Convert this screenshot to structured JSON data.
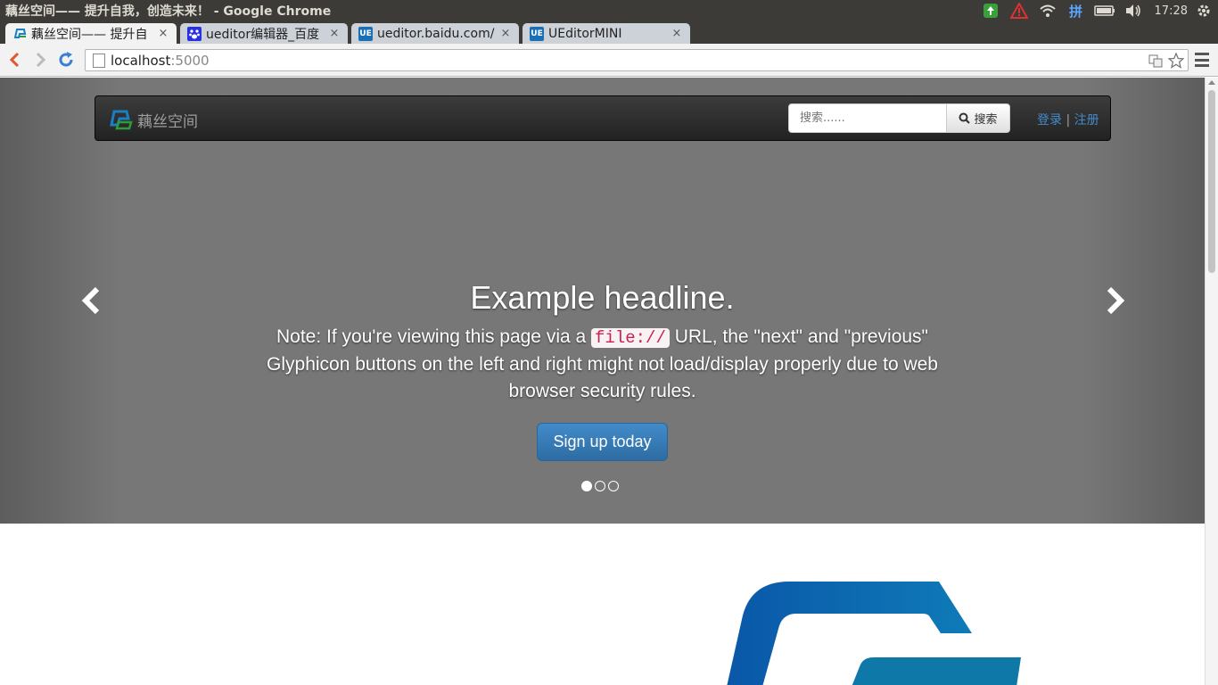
{
  "os": {
    "window_title": "藕丝空间—— 提升自我，创造未来！ - Google Chrome",
    "clock": "17:28",
    "input_method": "拼"
  },
  "tabs": [
    {
      "label": "藕丝空间—— 提升自",
      "close": "×",
      "favicon": "ousi-logo-icon",
      "active": true
    },
    {
      "label": "ueditor编辑器_百度",
      "close": "×",
      "favicon": "baidu-paw-icon",
      "active": false
    },
    {
      "label": "ueditor.baidu.com/",
      "close": "×",
      "favicon_text": "UE",
      "active": false
    },
    {
      "label": "UEditorMINI",
      "close": "×",
      "favicon_text": "UE",
      "active": false
    }
  ],
  "address_bar": {
    "host": "localhost",
    "port": ":5000"
  },
  "site": {
    "brand": "藕丝空间",
    "search_placeholder": "搜索......",
    "search_button": "搜索",
    "login": "登录",
    "separator": "|",
    "register": "注册"
  },
  "carousel": {
    "headline": "Example headline.",
    "note_before": "Note: If you're viewing this page via a",
    "note_code": "file://",
    "note_after": "URL, the \"next\" and \"previous\" Glyphicon buttons on the left and right might not load/display properly due to web browser security rules.",
    "cta": "Sign up today",
    "slide_count": 3,
    "active_slide": 1
  },
  "colors": {
    "link": "#428bca",
    "primary_button": "#428bca",
    "carousel_bg": "#777777",
    "navbar_bg": "#222222"
  }
}
